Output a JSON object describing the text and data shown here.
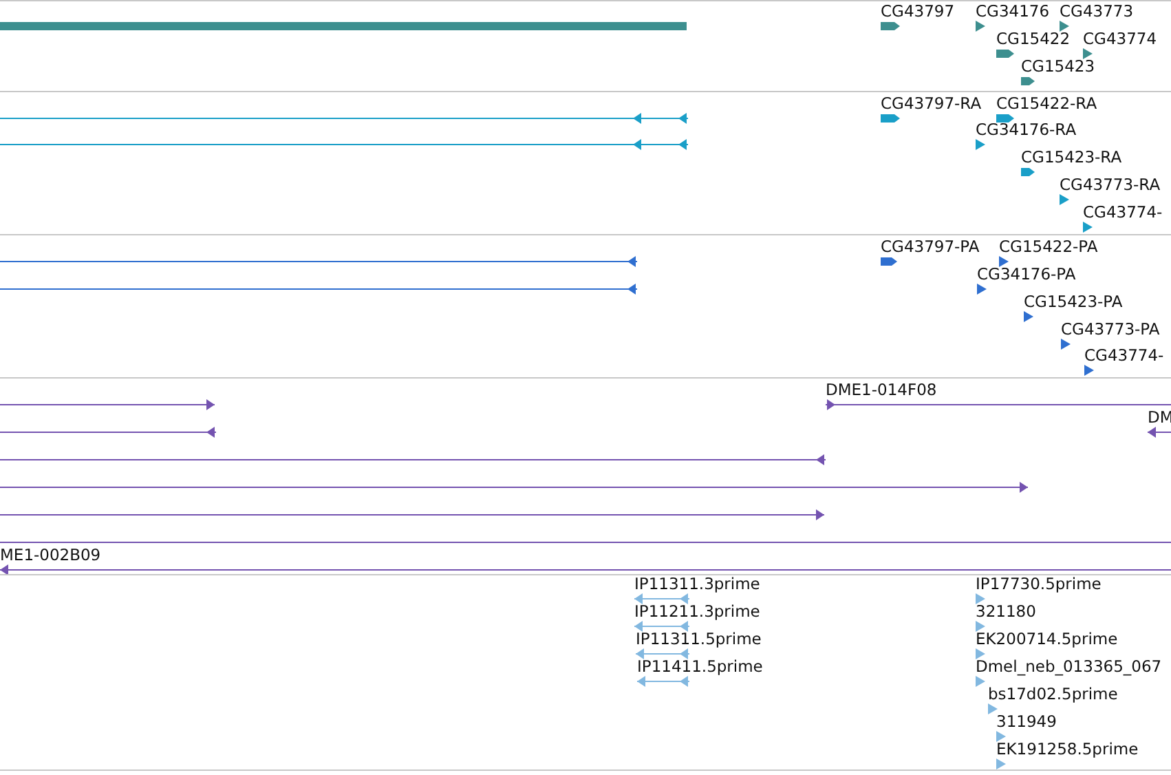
{
  "tracks": [
    {
      "color": "#3d8f8f",
      "features": [
        {
          "kind": "bar"
        },
        {
          "kind": "box",
          "label": "CG43797",
          "reverse": false
        },
        {
          "kind": "flag",
          "label": "CG34176",
          "reverse": false
        },
        {
          "kind": "flag",
          "label": "CG43773",
          "reverse": false
        },
        {
          "kind": "box",
          "label": "CG15422",
          "reverse": false
        },
        {
          "kind": "flag",
          "label": "CG43774",
          "reverse": false
        },
        {
          "kind": "box",
          "label": "CG15423",
          "reverse": false
        }
      ]
    },
    {
      "color": "#1a9fc8",
      "features": [
        {
          "kind": "exons",
          "reverse": true
        },
        {
          "kind": "exons",
          "reverse": true
        },
        {
          "kind": "box",
          "label": "CG43797-RA",
          "reverse": false
        },
        {
          "kind": "box",
          "label": "CG15422-RA",
          "reverse": false
        },
        {
          "kind": "flag",
          "label": "CG34176-RA",
          "reverse": false
        },
        {
          "kind": "box",
          "label": "CG15423-RA",
          "reverse": false
        },
        {
          "kind": "flag",
          "label": "CG43773-RA",
          "reverse": false
        },
        {
          "kind": "flag",
          "label": "CG43774-",
          "reverse": false
        }
      ]
    },
    {
      "color": "#2f6fd0",
      "features": [
        {
          "kind": "line",
          "reverse": true
        },
        {
          "kind": "line",
          "reverse": true
        },
        {
          "kind": "box",
          "label": "CG43797-PA",
          "reverse": false
        },
        {
          "kind": "flag",
          "label": "CG15422-PA",
          "reverse": false
        },
        {
          "kind": "flag",
          "label": "CG34176-PA",
          "reverse": false
        },
        {
          "kind": "flag",
          "label": "CG15423-PA",
          "reverse": false
        },
        {
          "kind": "flag",
          "label": "CG43773-PA",
          "reverse": false
        },
        {
          "kind": "flag",
          "label": "CG43774-",
          "reverse": false
        }
      ]
    },
    {
      "color": "#7453b0",
      "features": [
        {
          "kind": "line",
          "reverse": false
        },
        {
          "kind": "line",
          "reverse": true
        },
        {
          "kind": "line",
          "reverse": true
        },
        {
          "kind": "line",
          "reverse": false
        },
        {
          "kind": "line",
          "reverse": false
        },
        {
          "kind": "line",
          "label": "DME1-014F08",
          "reverse": false
        },
        {
          "kind": "line",
          "label": "DM",
          "reverse": true
        },
        {
          "kind": "line"
        },
        {
          "kind": "line",
          "label": "ME1-002B09",
          "reverse": true
        }
      ]
    },
    {
      "color": "#82b8e0",
      "features": [
        {
          "kind": "exons",
          "label": "IP11311.3prime",
          "reverse": true
        },
        {
          "kind": "exons",
          "label": "IP11211.3prime",
          "reverse": true
        },
        {
          "kind": "exons",
          "label": "IP11311.5prime",
          "reverse": true
        },
        {
          "kind": "exons",
          "label": "IP11411.5prime",
          "reverse": true
        },
        {
          "kind": "flag",
          "label": "IP17730.5prime",
          "reverse": false
        },
        {
          "kind": "flag",
          "label": "321180",
          "reverse": false
        },
        {
          "kind": "flag",
          "label": "EK200714.5prime",
          "reverse": false
        },
        {
          "kind": "flag",
          "label": "Dmel_neb_013365_067",
          "reverse": false
        },
        {
          "kind": "flag",
          "label": "bs17d02.5prime",
          "reverse": false
        },
        {
          "kind": "flag",
          "label": "311949",
          "reverse": false
        },
        {
          "kind": "flag",
          "label": "EK191258.5prime",
          "reverse": false
        }
      ]
    }
  ]
}
